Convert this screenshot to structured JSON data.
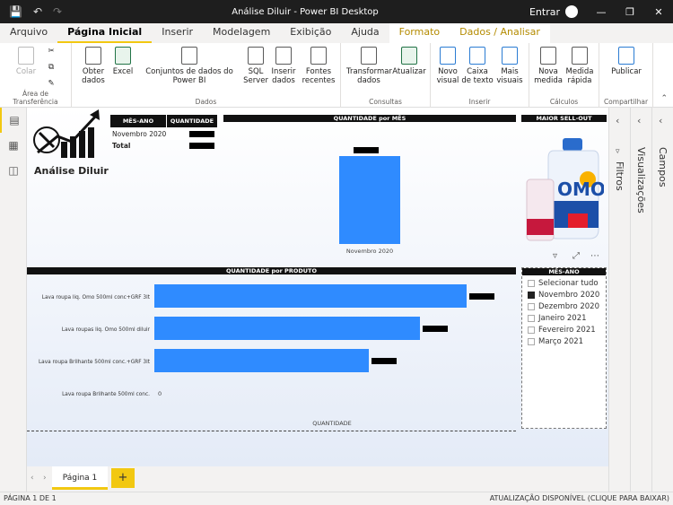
{
  "window": {
    "title": "Análise Diluir - Power BI Desktop",
    "signin": "Entrar"
  },
  "tabs": [
    {
      "label": "Arquivo"
    },
    {
      "label": "Página Inicial"
    },
    {
      "label": "Inserir"
    },
    {
      "label": "Modelagem"
    },
    {
      "label": "Exibição"
    },
    {
      "label": "Ajuda"
    },
    {
      "label": "Formato"
    },
    {
      "label": "Dados / Analisar"
    }
  ],
  "ribbon": {
    "clipboard": {
      "paste": "Colar",
      "group": "Área de Transferência"
    },
    "data": {
      "get": "Obter dados",
      "excel": "Excel",
      "datasets": "Conjuntos de dados do Power BI",
      "sql": "SQL Server",
      "enter": "Inserir dados",
      "recent": "Fontes recentes",
      "group": "Dados"
    },
    "queries": {
      "transform": "Transformar dados",
      "refresh": "Atualizar",
      "group": "Consultas"
    },
    "insert": {
      "newvisual": "Novo visual",
      "textbox": "Caixa de texto",
      "more": "Mais visuais",
      "group": "Inserir"
    },
    "calc": {
      "newmeasure": "Nova medida",
      "quickmeasure": "Medida rápida",
      "group": "Cálculos"
    },
    "share": {
      "publish": "Publicar",
      "group": "Compartilhar"
    }
  },
  "report": {
    "logo_text": "Análise Diluir",
    "table": {
      "headers": [
        "MÊS-ANO",
        "QUANTIDADE"
      ],
      "row": "Novembro 2020",
      "total": "Total"
    },
    "column_chart_title": "QUANTIDADE por MÊS",
    "sellout_title": "MAIOR SELL-OUT",
    "bar_chart_title": "QUANTIDADE por PRODUTO",
    "bar_axis_label": "QUANTIDADE",
    "slicer_title": "MÊS-ANO",
    "slicer_items": [
      {
        "label": "Selecionar tudo",
        "checked": false
      },
      {
        "label": "Novembro 2020",
        "checked": true
      },
      {
        "label": "Dezembro 2020",
        "checked": false
      },
      {
        "label": "Janeiro 2021",
        "checked": false
      },
      {
        "label": "Fevereiro 2021",
        "checked": false
      },
      {
        "label": "Março 2021",
        "checked": false
      }
    ],
    "product_image_label": "OMO",
    "zero_label": "0"
  },
  "panels": {
    "filters": "Filtros",
    "visualizations": "Visualizações",
    "fields": "Campos"
  },
  "page_tabs": [
    {
      "label": "Página 1"
    }
  ],
  "status": {
    "page": "PÁGINA 1 DE 1",
    "update": "ATUALIZAÇÃO DISPONÍVEL (CLIQUE PARA BAIXAR)"
  },
  "chart_data": [
    {
      "type": "bar",
      "title": "QUANTIDADE por MÊS",
      "categories": [
        "Novembro 2020"
      ],
      "values": [
        1
      ],
      "orientation": "vertical"
    },
    {
      "type": "bar",
      "title": "QUANTIDADE por PRODUTO",
      "xlabel": "QUANTIDADE",
      "orientation": "horizontal",
      "categories": [
        "Lava roupa liq. Omo 500ml conc+GRF 3lt",
        "Lava roupas liq. Omo 500ml diluir",
        "Lava roupa Brilhante 500ml conc.+GRF 3lt",
        "Lava roupa Brilhante 500ml conc."
      ],
      "values": [
        348,
        296,
        239,
        0
      ]
    }
  ]
}
